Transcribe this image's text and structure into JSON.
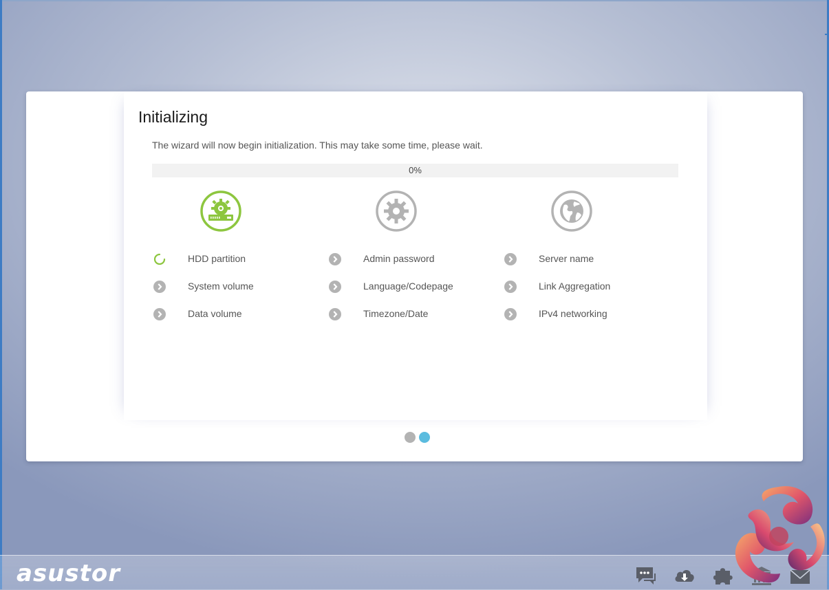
{
  "wizard": {
    "title": "Initializing",
    "description": "The wizard will now begin initialization. This may take some time, please wait.",
    "progress_value": 0,
    "progress_label": "0%",
    "columns": [
      {
        "icon": "disk-gear-icon",
        "active": true,
        "steps": [
          {
            "label": "HDD partition",
            "status": "in-progress"
          },
          {
            "label": "System volume",
            "status": "pending"
          },
          {
            "label": "Data volume",
            "status": "pending"
          }
        ]
      },
      {
        "icon": "gear-icon",
        "active": false,
        "steps": [
          {
            "label": "Admin password",
            "status": "pending"
          },
          {
            "label": "Language/Codepage",
            "status": "pending"
          },
          {
            "label": "Timezone/Date",
            "status": "pending"
          }
        ]
      },
      {
        "icon": "globe-icon",
        "active": false,
        "steps": [
          {
            "label": "Server name",
            "status": "pending"
          },
          {
            "label": "Link Aggregation",
            "status": "pending"
          },
          {
            "label": "IPv4 networking",
            "status": "pending"
          }
        ]
      }
    ],
    "pagination": {
      "pages": 2,
      "current": 2
    }
  },
  "taskbar": {
    "brand": "asustor",
    "icons": [
      "chat-icon",
      "cloud-download-icon",
      "plugin-icon",
      "storage-building-icon",
      "mail-icon"
    ]
  },
  "colors": {
    "active_green": "#8dc63f",
    "inactive_gray": "#b3b3b3",
    "page_dot_active": "#5bbcdf",
    "page_dot_inactive": "#b3b3b3"
  }
}
